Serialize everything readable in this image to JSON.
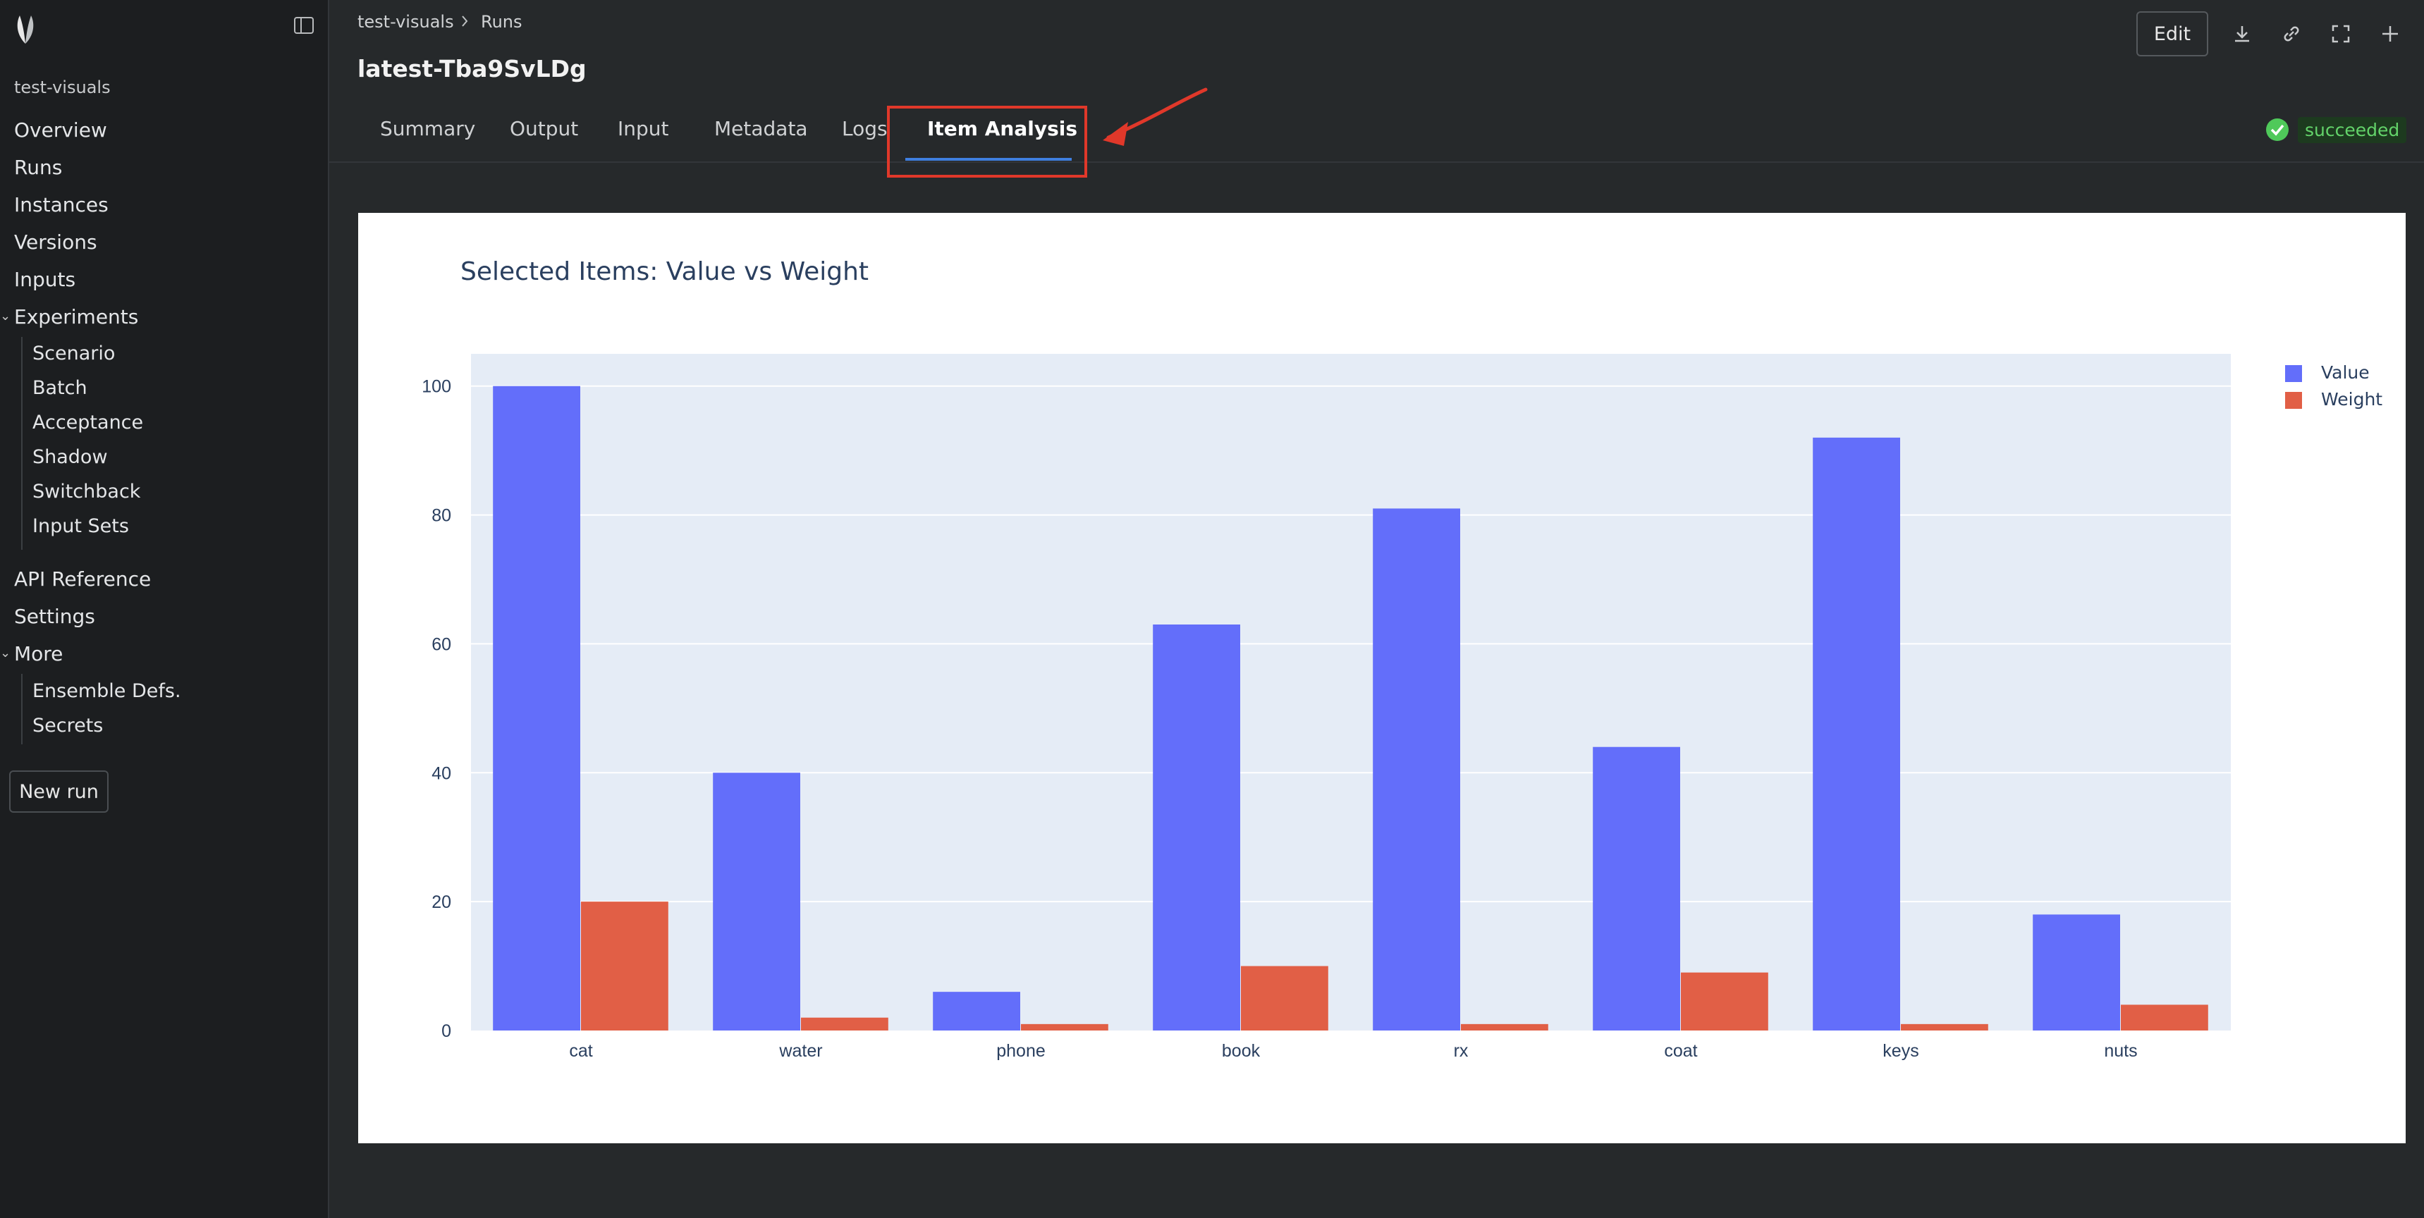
{
  "sidebar": {
    "project": "test-visuals",
    "items": [
      "Overview",
      "Runs",
      "Instances",
      "Versions",
      "Inputs"
    ],
    "experiments": {
      "label": "Experiments",
      "children": [
        "Scenario",
        "Batch",
        "Acceptance",
        "Shadow",
        "Switchback",
        "Input Sets"
      ]
    },
    "items2": [
      "API Reference",
      "Settings"
    ],
    "more": {
      "label": "More",
      "children": [
        "Ensemble Defs.",
        "Secrets"
      ]
    },
    "new_run": "New run"
  },
  "breadcrumb": {
    "project": "test-visuals",
    "section": "Runs"
  },
  "title": "latest-Tba9SvLDg",
  "toolbar": {
    "edit": "Edit"
  },
  "tabs": [
    "Summary",
    "Output",
    "Input",
    "Metadata",
    "Logs",
    "Item Analysis"
  ],
  "active_tab": "Item Analysis",
  "status": "succeeded",
  "colors": {
    "value": "#636efa",
    "weight": "#e15f46",
    "status": "#63d36a",
    "highlight": "#e0382a"
  },
  "chart_data": {
    "type": "bar",
    "title": "Selected Items: Value vs Weight",
    "categories": [
      "cat",
      "water",
      "phone",
      "book",
      "rx",
      "coat",
      "keys",
      "nuts"
    ],
    "series": [
      {
        "name": "Value",
        "values": [
          100,
          40,
          6,
          63,
          81,
          44,
          92,
          18
        ]
      },
      {
        "name": "Weight",
        "values": [
          20,
          2,
          1,
          10,
          1,
          9,
          1,
          4
        ]
      }
    ],
    "ylim": [
      0,
      105
    ],
    "yticks": [
      0,
      20,
      40,
      60,
      80,
      100
    ],
    "grid": true,
    "legend": "top-right"
  }
}
